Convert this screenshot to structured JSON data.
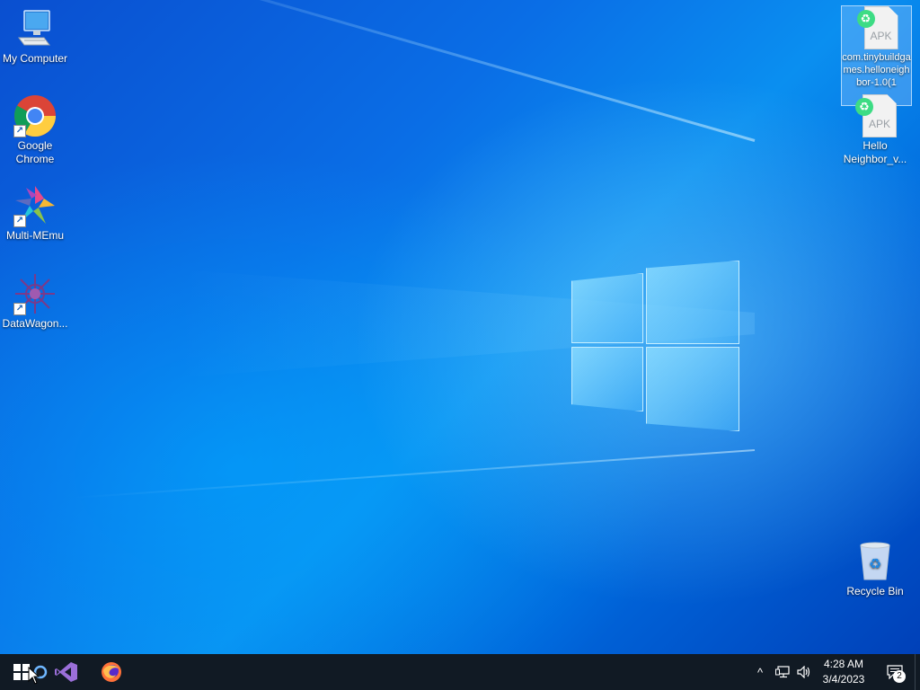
{
  "desktop": {
    "icons": [
      {
        "label": "My Computer",
        "icon": "computer-icon"
      },
      {
        "label": "Google Chrome",
        "icon": "chrome-icon"
      },
      {
        "label": "Multi-MEmu",
        "icon": "multimemu-icon"
      },
      {
        "label": "DataWagon...",
        "icon": "datawagon-icon"
      },
      {
        "label": "com.tinybuildgames.helloneighbor-1.0(1",
        "badge_text": "APK",
        "icon": "apk-file-icon",
        "selected": true
      },
      {
        "label": "Hello Neighbor_v...",
        "badge_text": "APK",
        "icon": "apk-file-icon"
      },
      {
        "label": "Recycle Bin",
        "icon": "recycle-bin-icon"
      }
    ]
  },
  "taskbar": {
    "pinned": [
      "start-icon",
      "cortana-icon",
      "visual-studio-icon",
      "firefox-icon"
    ],
    "tray": {
      "chevron": "^",
      "time": "4:28 AM",
      "date": "3/4/2023",
      "notifications_count": "2"
    }
  },
  "colors": {
    "taskbar": "#111a24",
    "wallpaper_accent": "#0a8ff0"
  }
}
